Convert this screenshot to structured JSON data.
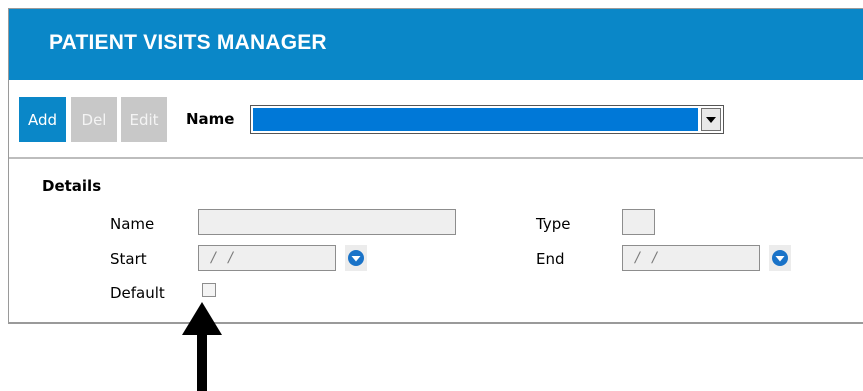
{
  "header": {
    "title": "PATIENT VISITS MANAGER"
  },
  "toolbar": {
    "add_label": "Add",
    "del_label": "Del",
    "edit_label": "Edit",
    "name_label": "Name",
    "name_selected_value": ""
  },
  "details": {
    "section_title": "Details",
    "name_label": "Name",
    "name_value": "",
    "type_label": "Type",
    "type_value": "",
    "start_label": "Start",
    "start_value": "/ /",
    "end_label": "End",
    "end_value": "/ /",
    "default_label": "Default",
    "default_checked": false
  },
  "icons": {
    "select_arrow": "chevron-down-icon",
    "date_picker": "circle-arrow-down-icon",
    "annotation_arrow": "arrow-up-icon"
  },
  "colors": {
    "accent": "#0a87c8",
    "disabled_button": "#c8c8c8",
    "selection": "#0078d7",
    "date_icon": "#1a73c8"
  }
}
